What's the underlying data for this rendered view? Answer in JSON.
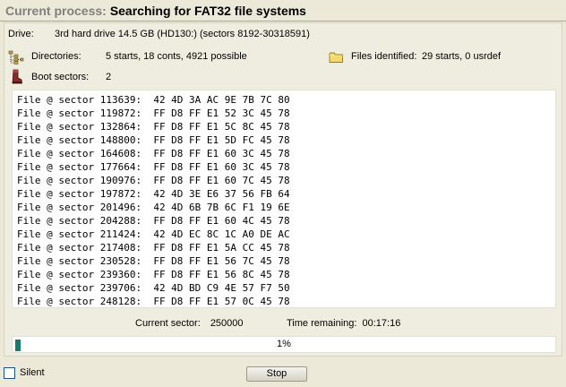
{
  "title": {
    "label": "Current process:",
    "value": "Searching for FAT32 file systems"
  },
  "drive": {
    "label": "Drive:",
    "value": "3rd hard drive 14.5 GB (HD130:) (sectors 8192-30318591)"
  },
  "directories": {
    "icon": "directory-tree-icon",
    "label": "Directories:",
    "value": "5 starts, 18 conts, 4921 possible"
  },
  "files_identified": {
    "icon": "folder-icon",
    "label": "Files identified:",
    "value": "29 starts, 0 usrdef"
  },
  "boot_sectors": {
    "icon": "boot-icon",
    "label": "Boot sectors:",
    "value": "2"
  },
  "file_log": [
    "File @ sector 113639:  42 4D 3A AC 9E 7B 7C 80",
    "File @ sector 119872:  FF D8 FF E1 52 3C 45 78",
    "File @ sector 132864:  FF D8 FF E1 5C 8C 45 78",
    "File @ sector 148800:  FF D8 FF E1 5D FC 45 78",
    "File @ sector 164608:  FF D8 FF E1 60 3C 45 78",
    "File @ sector 177664:  FF D8 FF E1 60 3C 45 78",
    "File @ sector 190976:  FF D8 FF E1 60 7C 45 78",
    "File @ sector 197872:  42 4D 3E E6 37 56 FB 64",
    "File @ sector 201496:  42 4D 6B 7B 6C F1 19 6E",
    "File @ sector 204288:  FF D8 FF E1 60 4C 45 78",
    "File @ sector 211424:  42 4D EC 8C 1C A0 DE AC",
    "File @ sector 217408:  FF D8 FF E1 5A CC 45 78",
    "File @ sector 230528:  FF D8 FF E1 56 7C 45 78",
    "File @ sector 239360:  FF D8 FF E1 56 8C 45 78",
    "File @ sector 239706:  42 4D BD C9 4E 57 F7 50",
    "File @ sector 248128:  FF D8 FF E1 57 0C 45 78"
  ],
  "status": {
    "current_sector_label": "Current sector:",
    "current_sector_value": "250000",
    "time_remaining_label": "Time remaining:",
    "time_remaining_value": "00:17:16"
  },
  "progress": {
    "percent_text": "1%",
    "fraction": 0.01,
    "color": "#1a7a72"
  },
  "silent": {
    "label": "Silent",
    "checked": false
  },
  "stop_button": {
    "label": "Stop"
  }
}
